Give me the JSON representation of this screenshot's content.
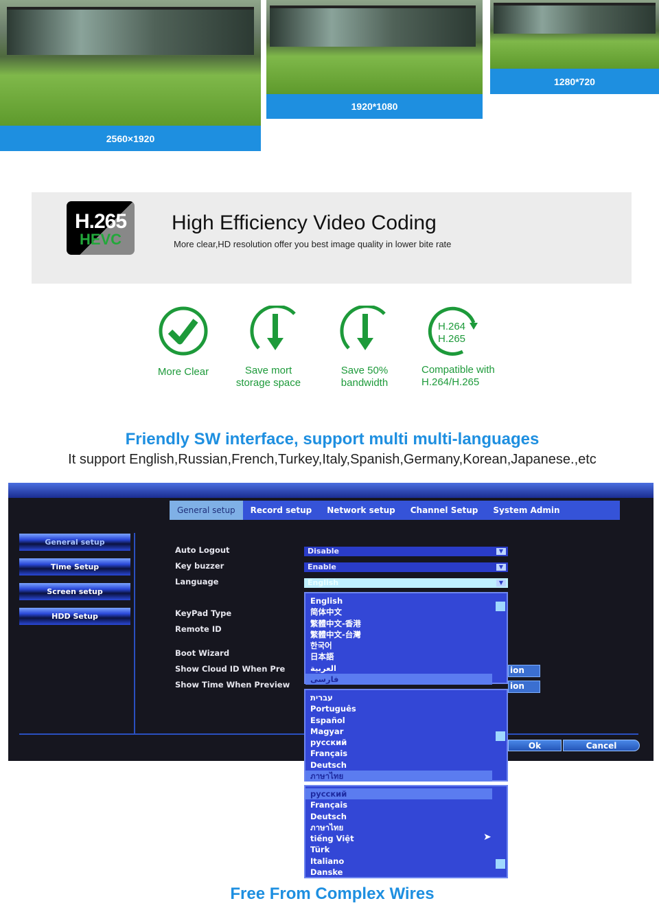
{
  "resolutions": [
    "2560×1920",
    "1920*1080",
    "1280*720"
  ],
  "hevc": {
    "logo_top": "H.265",
    "logo_bottom": "HEVC",
    "title": "High Efficiency Video Coding",
    "subtitle": "More clear,HD resolution offer you best image quality in lower bite rate"
  },
  "features": [
    {
      "icon": "check-circle",
      "label": "More Clear"
    },
    {
      "icon": "down-arrow-circle",
      "label": "Save mort storage space"
    },
    {
      "icon": "down-arrow-circle",
      "label": "Save 50% bandwidth"
    },
    {
      "icon": "refresh-circle",
      "label": "Compatible with H.264/H.265",
      "icon_text_1": "H.264",
      "icon_text_2": "H.265"
    }
  ],
  "colors": {
    "accent_blue": "#1e8fe0",
    "green": "#1d9a3a",
    "dvr_blue": "#3553d8"
  },
  "sw_section": {
    "heading": "Friendly SW interface, support multi multi-languages",
    "subheading": "It support English,Russian,French,Turkey,Italy,Spanish,Germany,Korean,Japanese.,etc"
  },
  "dvr": {
    "tabs": [
      "General setup",
      "Record setup",
      "Network setup",
      "Channel Setup",
      "System Admin"
    ],
    "active_tab": "General setup",
    "sidebar": [
      "General setup",
      "Time Setup",
      "Screen setup",
      "HDD Setup"
    ],
    "fields": {
      "auto_logout": {
        "label": "Auto Logout",
        "value": "Disable"
      },
      "key_buzzer": {
        "label": "Key buzzer",
        "value": "Enable"
      },
      "language": {
        "label": "Language",
        "value": "English"
      },
      "keypad_type": {
        "label": "KeyPad Type"
      },
      "remote_id": {
        "label": "Remote ID"
      },
      "boot_wizard": {
        "label": "Boot Wizard"
      },
      "show_cloud_id": {
        "label": "Show Cloud ID When Pre"
      },
      "show_time": {
        "label": "Show Time When Preview"
      }
    },
    "position_btn": "ion",
    "ok": "Ok",
    "cancel": "Cancel",
    "language_list_1": [
      "English",
      "简体中文",
      "繁體中文-香港",
      "繁體中文-台灣",
      "한국어",
      "日本語",
      "العربية",
      "فارسی"
    ],
    "language_list_2": [
      "עברית",
      "Português",
      "Español",
      "Magyar",
      "русский",
      "Français",
      "Deutsch",
      "ภาษาไทย"
    ],
    "language_list_3": [
      "русский",
      "Français",
      "Deutsch",
      "ภาษาไทย",
      "tiếng Việt",
      "Türk",
      "Italiano",
      "Danske"
    ]
  },
  "footer": "Free From Complex Wires"
}
